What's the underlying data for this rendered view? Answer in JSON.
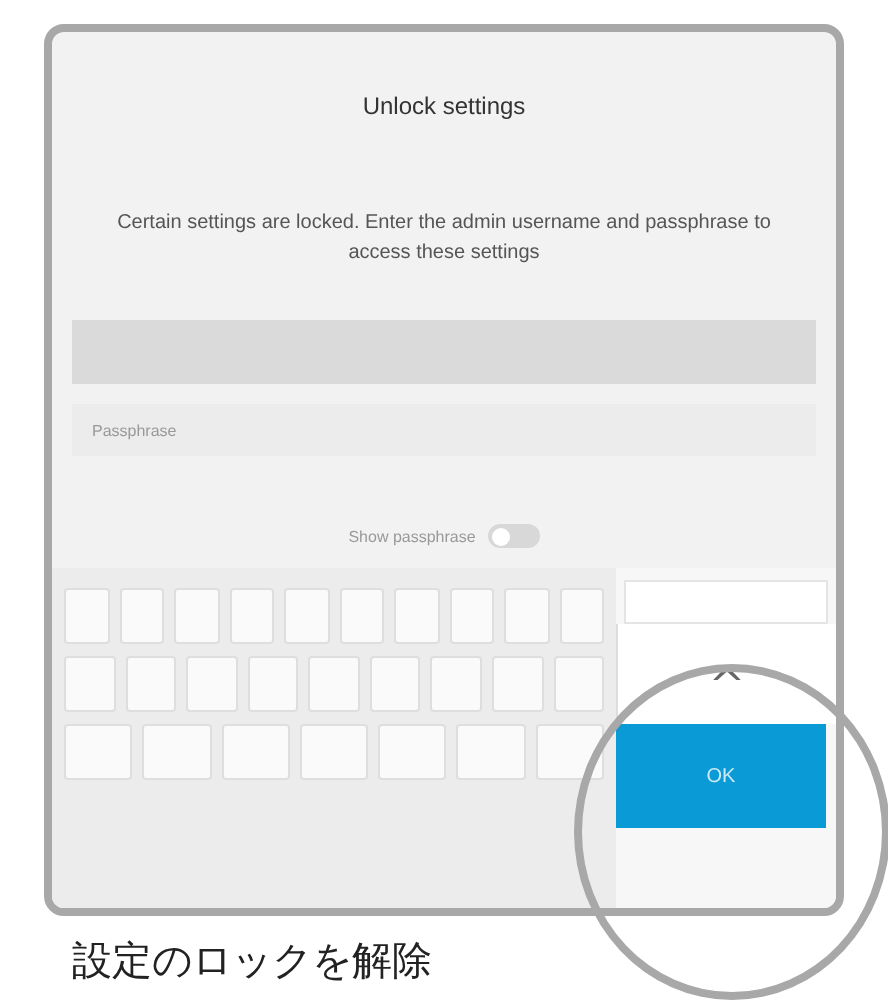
{
  "dialog": {
    "title": "Unlock settings",
    "message": "Certain settings are locked. Enter the admin username and passphrase to access these settings",
    "passphrase_field": {
      "placeholder": "Passphrase"
    },
    "toggle": {
      "label": "Show passphrase",
      "on": false
    }
  },
  "keyboard": {
    "up_key": "^",
    "ok_key": "OK"
  },
  "caption": "設定のロックを解除"
}
